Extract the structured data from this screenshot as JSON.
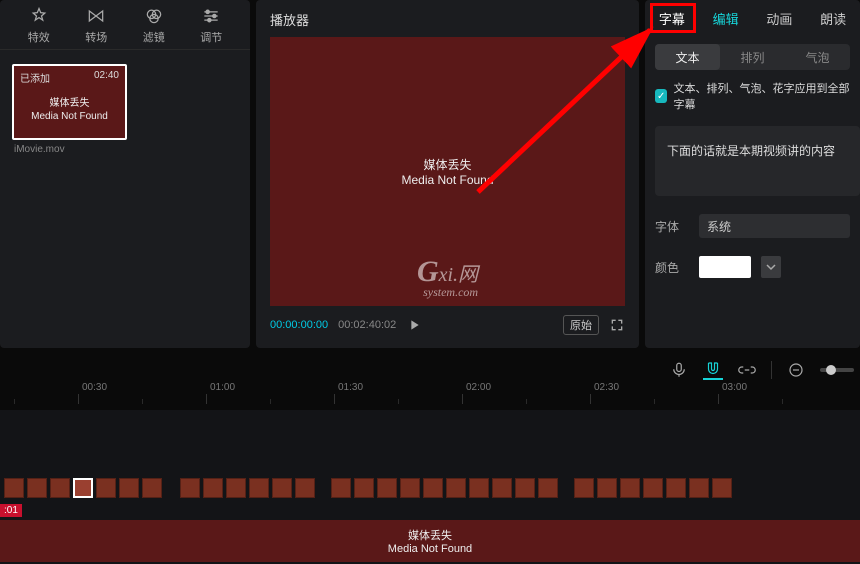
{
  "tools": {
    "fx": "特效",
    "transition": "转场",
    "filter": "滤镜",
    "adjust": "调节"
  },
  "media": {
    "badge": "已添加",
    "duration": "02:40",
    "missing_cn": "媒体丢失",
    "missing_en": "Media Not Found",
    "filename": "iMovie.mov"
  },
  "player": {
    "title": "播放器",
    "missing_cn": "媒体丢失",
    "missing_en": "Media Not Found",
    "tc_current": "00:00:00:00",
    "tc_total": "00:02:40:02",
    "original_btn": "原始"
  },
  "right": {
    "tabs": {
      "subtitle": "字幕",
      "edit": "编辑",
      "animate": "动画",
      "read": "朗读"
    },
    "subtabs": {
      "text": "文本",
      "arrange": "排列",
      "bubble": "气泡"
    },
    "apply_all": "文本、排列、气泡、花字应用到全部字幕",
    "textarea_value": "下面的话就是本期视频讲的内容",
    "font_label": "字体",
    "font_value": "系统",
    "color_label": "颜色",
    "color_value": "#ffffff"
  },
  "ruler": [
    "00:30",
    "01:00",
    "01:30",
    "02:00",
    "02:30",
    "03:00"
  ],
  "timeline": {
    "time_tag": ":01",
    "track_missing_cn": "媒体丢失",
    "track_missing_en": "Media Not Found"
  },
  "watermark": {
    "big": "G",
    "text": "xi.网",
    "sub": "system.com"
  }
}
